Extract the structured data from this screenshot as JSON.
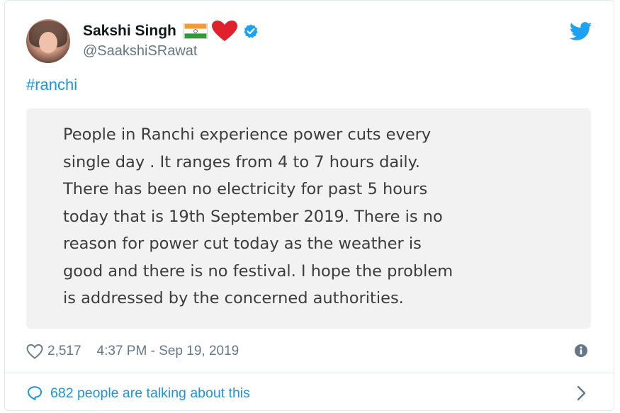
{
  "tweet": {
    "author": {
      "display_name": "Sakshi Singh",
      "handle": "@SaakshiSRawat",
      "verified": true,
      "emoji": [
        "indian-flag",
        "red-heart"
      ]
    },
    "hashtag": "#ranchi",
    "image_text": "People in Ranchi experience power cuts every\nsingle day . It ranges from 4 to 7 hours daily.\nThere has been no electricity for past 5 hours\ntoday that is 19th September 2019. There is no\nreason for power cut today as the weather is\ngood and there is no festival. I hope the problem\nis addressed by the concerned authorities.",
    "likes": "2,517",
    "timestamp": "4:37 PM - Sep 19, 2019",
    "talking": "682 people are talking about this"
  },
  "colors": {
    "link": "#1b95e0",
    "verified": "#1da1f2",
    "secondary_text": "#657786",
    "media_bg": "#f2f2f2"
  },
  "icons": [
    "twitter-bird-icon",
    "verified-badge-icon",
    "heart-icon",
    "info-icon",
    "reply-bubble-icon",
    "chevron-right-icon"
  ]
}
